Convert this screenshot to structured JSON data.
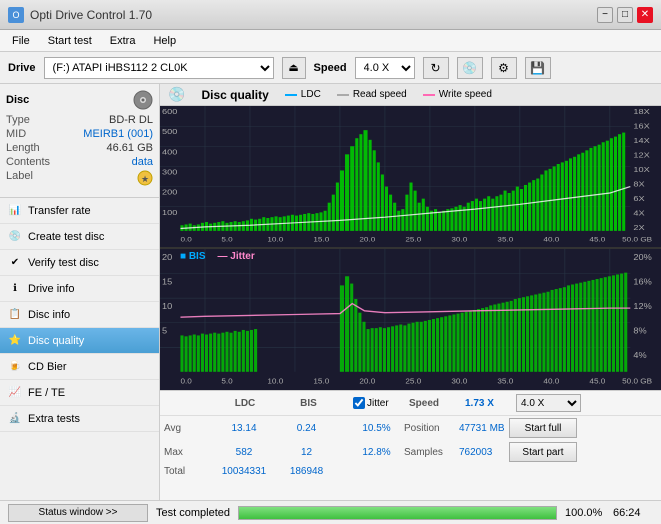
{
  "titlebar": {
    "title": "Opti Drive Control 1.70",
    "minimize_label": "−",
    "maximize_label": "□",
    "close_label": "✕"
  },
  "menubar": {
    "items": [
      "File",
      "Start test",
      "Extra",
      "Help"
    ]
  },
  "drivebar": {
    "label": "Drive",
    "drive_value": "(F:)  ATAPI iHBS112  2 CL0K",
    "speed_label": "Speed",
    "speed_value": "4.0 X"
  },
  "disc": {
    "header": "Disc",
    "type_label": "Type",
    "type_value": "BD-R DL",
    "mid_label": "MID",
    "mid_value": "MEIRB1 (001)",
    "length_label": "Length",
    "length_value": "46.61 GB",
    "contents_label": "Contents",
    "contents_value": "data",
    "label_label": "Label"
  },
  "nav": {
    "items": [
      {
        "id": "transfer-rate",
        "label": "Transfer rate",
        "icon": "📊"
      },
      {
        "id": "create-test-disc",
        "label": "Create test disc",
        "icon": "💿"
      },
      {
        "id": "verify-test-disc",
        "label": "Verify test disc",
        "icon": "✔"
      },
      {
        "id": "drive-info",
        "label": "Drive info",
        "icon": "ℹ"
      },
      {
        "id": "disc-info",
        "label": "Disc info",
        "icon": "📋"
      },
      {
        "id": "disc-quality",
        "label": "Disc quality",
        "icon": "⭐",
        "active": true
      },
      {
        "id": "cd-bier",
        "label": "CD Bier",
        "icon": "🍺"
      },
      {
        "id": "fe-te",
        "label": "FE / TE",
        "icon": "📈"
      },
      {
        "id": "extra-tests",
        "label": "Extra tests",
        "icon": "🔬"
      }
    ]
  },
  "chart_header": {
    "title": "Disc quality",
    "refresh_icon": "↻",
    "legend": [
      {
        "label": "LDC",
        "color": "#00aaff"
      },
      {
        "label": "Read speed",
        "color": "#ffffff"
      },
      {
        "label": "Write speed",
        "color": "#ff69b4"
      }
    ]
  },
  "chart1": {
    "y_labels_right": [
      "18X",
      "16X",
      "14X",
      "12X",
      "10X",
      "8X",
      "6X",
      "4X",
      "2X"
    ],
    "y_labels_left": [
      "600",
      "500",
      "400",
      "300",
      "200",
      "100"
    ],
    "x_labels": [
      "0.0",
      "5.0",
      "10.0",
      "15.0",
      "20.0",
      "25.0",
      "30.0",
      "35.0",
      "40.0",
      "45.0",
      "50.0 GB"
    ]
  },
  "chart2": {
    "title_bis": "BIS",
    "title_jitter": "Jitter",
    "y_labels_right": [
      "20%",
      "16%",
      "12%",
      "8%",
      "4%"
    ],
    "y_labels_left": [
      "20",
      "15",
      "10",
      "5"
    ],
    "x_labels": [
      "0.0",
      "5.0",
      "10.0",
      "15.0",
      "20.0",
      "25.0",
      "30.0",
      "35.0",
      "40.0",
      "45.0",
      "50.0 GB"
    ]
  },
  "stats": {
    "col_headers": [
      "",
      "LDC",
      "BIS",
      "",
      "Jitter",
      "Speed",
      ""
    ],
    "avg_label": "Avg",
    "avg_ldc": "13.14",
    "avg_bis": "0.24",
    "avg_jitter": "10.5%",
    "speed_label": "Speed",
    "speed_value": "1.73 X",
    "speed_select": "4.0 X",
    "max_label": "Max",
    "max_ldc": "582",
    "max_bis": "12",
    "max_jitter": "12.8%",
    "position_label": "Position",
    "position_value": "47731 MB",
    "total_label": "Total",
    "total_ldc": "10034331",
    "total_bis": "186948",
    "samples_label": "Samples",
    "samples_value": "762003",
    "start_full_label": "Start full",
    "start_part_label": "Start part",
    "jitter_checked": true,
    "jitter_label": "Jitter"
  },
  "statusbar": {
    "window_btn": "Status window >>",
    "status_text": "Test completed",
    "progress_pct": 100,
    "progress_display": "100.0%",
    "time_display": "66:24"
  }
}
